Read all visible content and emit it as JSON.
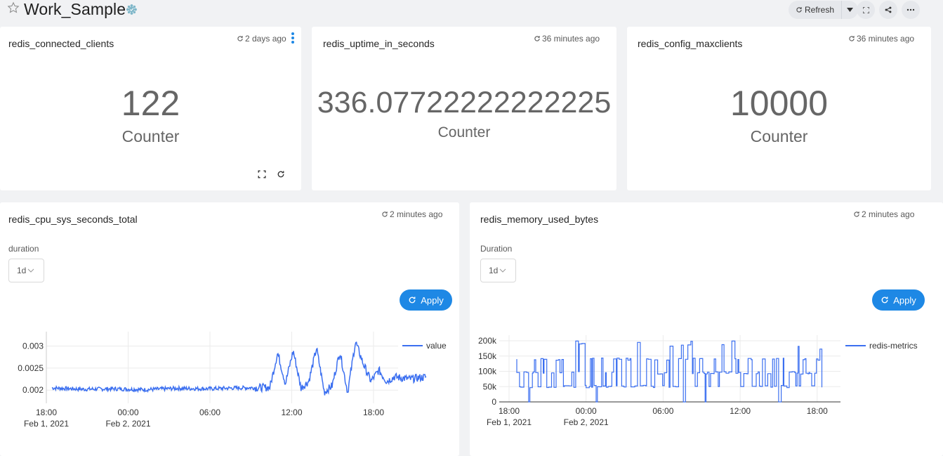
{
  "dashboard": {
    "title": "Work_Sample",
    "refresh_label": "Refresh"
  },
  "cards": {
    "clients": {
      "title": "redis_connected_clients",
      "updated": "2 days ago",
      "value": "122",
      "subtitle": "Counter"
    },
    "uptime": {
      "title": "redis_uptime_in_seconds",
      "updated": "36 minutes ago",
      "value": "336.07722222222225",
      "subtitle": "Counter"
    },
    "maxclients": {
      "title": "redis_config_maxclients",
      "updated": "36 minutes ago",
      "value": "10000",
      "subtitle": "Counter"
    },
    "cpu": {
      "title": "redis_cpu_sys_seconds_total",
      "updated": "2 minutes ago",
      "filter_label": "duration",
      "filter_value": "1d",
      "apply_label": "Apply"
    },
    "memory": {
      "title": "redis_memory_used_bytes",
      "updated": "2 minutes ago",
      "filter_label": "Duration",
      "filter_value": "1d",
      "apply_label": "Apply"
    }
  },
  "colors": {
    "accent": "#1e88e5",
    "line": "#3b6ff0"
  },
  "icons": [
    "star-icon",
    "certified-icon",
    "refresh-icon",
    "caret-down-icon",
    "fullscreen-icon",
    "share-icon",
    "more-icon",
    "kebab-menu-icon"
  ],
  "chart_data": [
    {
      "type": "line",
      "title": "",
      "legend": "top-right",
      "series": [
        {
          "name": "value"
        }
      ],
      "ylim": [
        0.0017,
        0.0032
      ],
      "yticks": [
        "0.002",
        "0.0025",
        "0.003"
      ],
      "xticks": [
        "18:00",
        "00:00",
        "06:00",
        "12:00",
        "18:00"
      ],
      "xsublabels": [
        "Feb 1, 2021",
        "Feb 2, 2021",
        "",
        "",
        ""
      ],
      "x_hours": [
        0,
        2,
        4,
        6,
        8,
        10,
        12,
        14,
        14.5,
        15,
        15.5,
        16,
        16.5,
        17,
        17.5,
        18,
        18.5,
        19,
        19.5,
        20,
        20.5,
        21,
        21.5,
        22,
        23,
        24
      ],
      "y_values": [
        0.00205,
        0.00202,
        0.00203,
        0.00201,
        0.00204,
        0.00203,
        0.00205,
        0.00206,
        0.00285,
        0.00215,
        0.0029,
        0.00205,
        0.0022,
        0.00295,
        0.00195,
        0.0021,
        0.00287,
        0.00195,
        0.0031,
        0.0026,
        0.0022,
        0.00245,
        0.0022,
        0.0023,
        0.00225,
        0.0023
      ],
      "grid": true
    },
    {
      "type": "line",
      "title": "",
      "legend": "top-right",
      "series": [
        {
          "name": "redis-metrics"
        }
      ],
      "ylim": [
        0,
        200000
      ],
      "yticks": [
        "0",
        "50k",
        "100k",
        "150k",
        "200k"
      ],
      "xticks": [
        "18:00",
        "00:00",
        "06:00",
        "12:00",
        "18:00"
      ],
      "xsublabels": [
        "Feb 1, 2021",
        "Feb 2, 2021",
        "",
        "",
        ""
      ],
      "levels": [
        50000,
        95000,
        140000
      ],
      "y_min": 0,
      "y_max": 200000,
      "grid": true
    }
  ]
}
